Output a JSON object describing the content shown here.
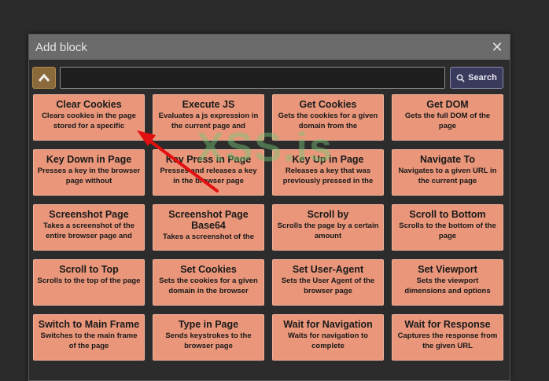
{
  "dialog": {
    "title": "Add block",
    "close_glyph": "✕"
  },
  "toolbar": {
    "search_value": "",
    "search_label": "Search"
  },
  "blocks": [
    {
      "title": "Clear Cookies",
      "desc": "Clears cookies in the page stored for a specific"
    },
    {
      "title": "Execute JS",
      "desc": "Evaluates a js expression in the current page and"
    },
    {
      "title": "Get Cookies",
      "desc": "Gets the cookies for a given domain from the"
    },
    {
      "title": "Get DOM",
      "desc": "Gets the full DOM of the page"
    },
    {
      "title": "Key Down in Page",
      "desc": "Presses a key in the browser page without"
    },
    {
      "title": "Key Press in Page",
      "desc": "Presses and releases a key in the browser page"
    },
    {
      "title": "Key Up in Page",
      "desc": "Releases a key that was previously pressed in the"
    },
    {
      "title": "Navigate To",
      "desc": "Navigates to a given URL in the current page"
    },
    {
      "title": "Screenshot Page",
      "desc": "Takes a screenshot of the entire browser page and"
    },
    {
      "title": "Screenshot Page Base64",
      "desc": "Takes a screenshot of the"
    },
    {
      "title": "Scroll by",
      "desc": "Scrolls the page by a certain amount"
    },
    {
      "title": "Scroll to Bottom",
      "desc": "Scrolls to the bottom of the page"
    },
    {
      "title": "Scroll to Top",
      "desc": "Scrolls to the top of the page"
    },
    {
      "title": "Set Cookies",
      "desc": "Sets the cookies for a given domain in the browser"
    },
    {
      "title": "Set User-Agent",
      "desc": "Sets the User Agent of the browser page"
    },
    {
      "title": "Set Viewport",
      "desc": "Sets the viewport dimensions and options"
    },
    {
      "title": "Switch to Main Frame",
      "desc": "Switches to the main frame of the page"
    },
    {
      "title": "Type in Page",
      "desc": "Sends keystrokes to the browser page"
    },
    {
      "title": "Wait for Navigation",
      "desc": "Waits for navigation to complete"
    },
    {
      "title": "Wait for Response",
      "desc": "Captures the response from the given URL"
    }
  ],
  "watermark": "XSS.is",
  "colors": {
    "block_bg": "#e9967a",
    "titlebar": "#6b6b6b",
    "arrow": "#e01010"
  }
}
